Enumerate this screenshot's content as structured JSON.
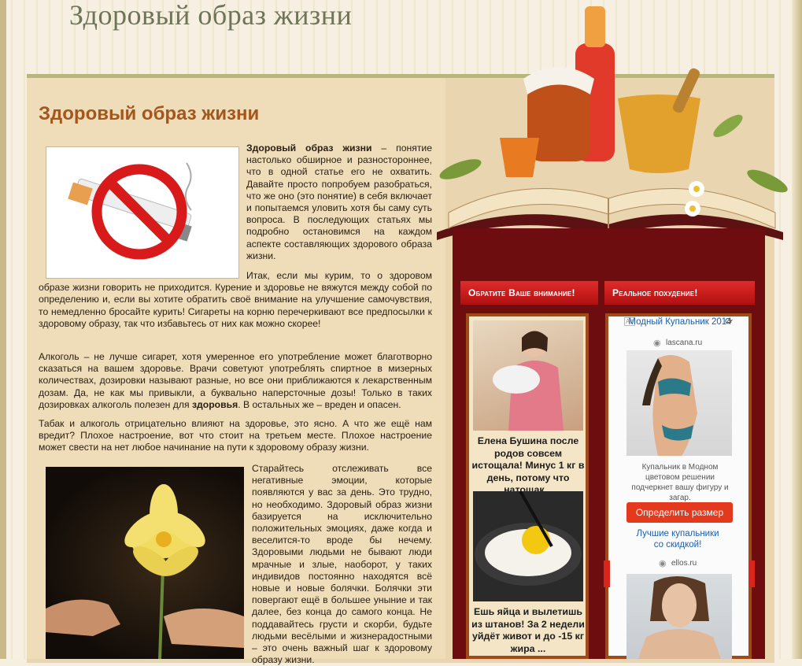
{
  "site": {
    "title": "Здоровый образ жизни"
  },
  "article": {
    "heading": "Здоровый образ жизни",
    "p1_bold": "Здоровый образ жизни",
    "p1_rest": " – понятие настолько обширное и разностороннее, что в одной статье его не охватить. Давайте просто попробуем разобраться, что же оно (это понятие) в себя включает и попытаемся уловить хотя бы саму суть вопроса. В последующих статьях мы подробно остановимся на каждом аспекте составляющих здорового образа жизни.",
    "p2": "Итак, если мы курим, то о здоровом образе жизни говорить не приходится. Курение и здоровье не вяжутся между собой по определению и, если вы хотите обратить своё внимание на улучшение самочувствия, то немедленно бросайте курить! Сигареты на корню перечеркивают все предпосылки к здоровому образу, так что избавьтесь от них как можно скорее!",
    "p3_a": "Алкоголь – не лучше сигарет, хотя умеренное его употребление может благотворно сказаться на вашем здоровье. Врачи советуют употреблять спиртное в мизерных количествах, дозировки называют разные, но все они приближаются к лекарственным дозам. Да, не как мы привыкли, а буквально наперсточные дозы! Только в таких дозировках алкоголь полезен для ",
    "p3_bold": "здоровья",
    "p3_b": ". В остальных же – вреден и опасен.",
    "p4": "Табак и алкоголь отрицательно влияют на здоровье, это ясно. А что же ещё нам вредит? Плохое настроение, вот что стоит на третьем месте. Плохое настроение может свести на нет любое начинание на пути к здоровому образу жизни.",
    "p5": "Старайтесь отслеживать все негативные эмоции, которые появляются у вас за день. Это трудно, но необходимо. Здоровый образ жизни базируется на исключительно положительных эмоциях, даже когда и веселится-то вроде бы нечему. Здоровыми людьми не бывают люди мрачные и злые, наоборот, у таких индивидов постоянно находятся всё новые и новые болячки. Болячки эти повергают ещё в большее уныние и так далее, без конца до самого конца. Не поддавайтесь грусти и скорби, будьте людьми весёлыми и жизнерадостными – это очень важный шаг к здоровому образу жизни."
  },
  "sidebar": {
    "tab1": "Обратите Ваше внимание!",
    "tab2": "Реальное похудение!",
    "news": [
      {
        "title": "Елена Бушина после родов совсем истощала! Минус 1 кг в день, потому что натощак..."
      },
      {
        "title": "Ешь яйца и вылетишь из штанов! За 2 недели уйдёт живот и до -15 кг жира ..."
      }
    ],
    "ads": [
      {
        "title": "Модный Купальник 2014",
        "domain": "lascana.ru",
        "text": "Купальник в Модном цветовом решении подчеркнет вашу фигуру и загар.",
        "button": "Определить размер"
      },
      {
        "title": "Лучшие купальники со скидкой!",
        "domain": "ellos.ru"
      }
    ]
  },
  "colors": {
    "heading": "#a4561c",
    "sidebar": "#6d0d10",
    "tab": "#e02b2b",
    "title": "#6e7458"
  }
}
